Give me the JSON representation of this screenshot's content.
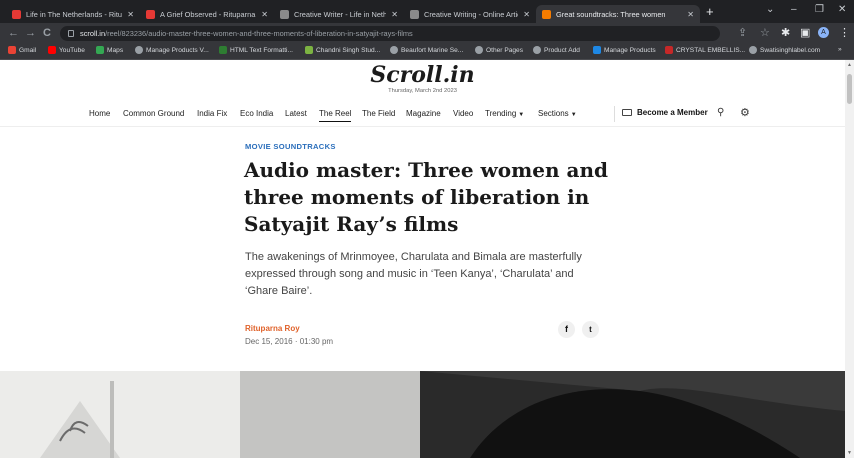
{
  "browser": {
    "tabs": [
      {
        "title": "Life in The Netherlands - Ritupar",
        "favicon_color": "#e53935",
        "active": false
      },
      {
        "title": "A Grief Observed - Rituparna Roy",
        "favicon_color": "#e53935",
        "active": false
      },
      {
        "title": "Creative Writer - Life in Netherla",
        "favicon_color": "#8a8a8a",
        "active": false
      },
      {
        "title": "Creative Writing - Online Articles",
        "favicon_color": "#8a8a8a",
        "active": false
      },
      {
        "title": "Great soundtracks: Three women",
        "favicon_color": "#f57c00",
        "active": true
      }
    ],
    "new_tab": "+",
    "window_controls": {
      "minimize": "–",
      "restore": "❐",
      "close": "✕"
    },
    "address": {
      "host": "scroll.in",
      "path": "/reel/823236/audio-master-three-women-and-three-moments-of-liberation-in-satyajit-rays-films"
    },
    "nav_icons": {
      "back": "←",
      "forward": "→",
      "reload": "C"
    },
    "profile_initial": "A",
    "bookmarks": [
      {
        "label": "Gmail",
        "icon_color": "#ea4335"
      },
      {
        "label": "YouTube",
        "icon_color": "#ff0000"
      },
      {
        "label": "Maps",
        "icon_color": "#34a853"
      },
      {
        "label": "Manage Products V...",
        "icon_color": "#9aa0a6"
      },
      {
        "label": "HTML Text Formatti...",
        "icon_color": "#2e7d32"
      },
      {
        "label": "Chandni Singh Stud...",
        "icon_color": "#7cb342"
      },
      {
        "label": "Beaufort Marine Se...",
        "icon_color": "#9aa0a6"
      },
      {
        "label": "Other Pages",
        "icon_color": "#9aa0a6"
      },
      {
        "label": "Product Add",
        "icon_color": "#9aa0a6"
      },
      {
        "label": "Manage Products",
        "icon_color": "#1e88e5"
      },
      {
        "label": "CRYSTAL EMBELLIS...",
        "icon_color": "#c62828"
      },
      {
        "label": "Swatisinghlabel.com",
        "icon_color": "#9aa0a6"
      }
    ],
    "bookmarks_more": "»"
  },
  "site": {
    "logo": "Scroll.in",
    "date": "Thursday, March 2nd 2023",
    "nav": [
      {
        "label": "Home"
      },
      {
        "label": "Common Ground"
      },
      {
        "label": "India Fix"
      },
      {
        "label": "Eco India"
      },
      {
        "label": "Latest"
      },
      {
        "label": "The Reel",
        "active": true
      },
      {
        "label": "The Field"
      },
      {
        "label": "Magazine"
      },
      {
        "label": "Video"
      },
      {
        "label": "Trending",
        "dropdown": true
      },
      {
        "label": "Sections",
        "dropdown": true
      }
    ],
    "member_label": "Become a Member",
    "search_icon": "search-icon",
    "settings_icon": "gear-icon"
  },
  "article": {
    "kicker": "MOVIE SOUNDTRACKS",
    "headline": "Audio master: Three women and three moments of liberation in Satyajit Ray’s films",
    "dek": "The awakenings of Mrinmoyee, Charulata and Bimala are masterfully expressed through song and music in ‘Teen Kanya’, ‘Charulata’ and ‘Ghare Baire’.",
    "author": "Rituparna Roy",
    "published": "Dec 15, 2016 · 01:30 pm",
    "share": {
      "facebook": "f",
      "twitter": "t"
    }
  },
  "colors": {
    "kicker": "#2a6ebb",
    "author": "#e0622a",
    "chrome_dark": "#202124",
    "chrome_mid": "#35363a"
  }
}
